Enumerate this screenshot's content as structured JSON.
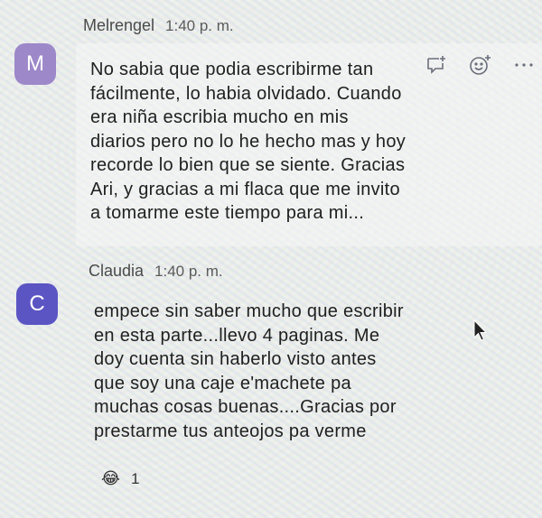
{
  "messages": [
    {
      "avatar_letter": "M",
      "author": "Melrengel",
      "time": "1:40 p. m.",
      "text": "No sabia que podia escribirme tan\nfácilmente, lo habia olvidado. Cuando\nera niña escribia mucho en mis\ndiarios pero no lo he hecho mas y hoy\nrecorde lo bien que se siente. Gracias\nAri, y gracias a mi flaca que me invito\na tomarme este tiempo para mi..."
    },
    {
      "avatar_letter": "C",
      "author": "Claudia",
      "time": "1:40 p. m.",
      "text": "empece sin saber mucho que escribir\nen esta parte...llevo 4 paginas.  Me\ndoy cuenta sin haberlo visto antes\nque soy una caje e'machete pa\nmuchas cosas buenas....Gracias por\nprestarme tus anteojos pa verme",
      "reaction": {
        "emoji": "😂",
        "count": "1"
      }
    }
  ],
  "colors": {
    "avatar_m": "#9d88c9",
    "avatar_c": "#5b55c4",
    "action_icon": "#6b6f7a"
  },
  "icons": {
    "actions": [
      "add-thread-reply-icon",
      "add-reaction-icon",
      "more-options-icon"
    ],
    "cursor": "mouse-pointer-icon"
  }
}
